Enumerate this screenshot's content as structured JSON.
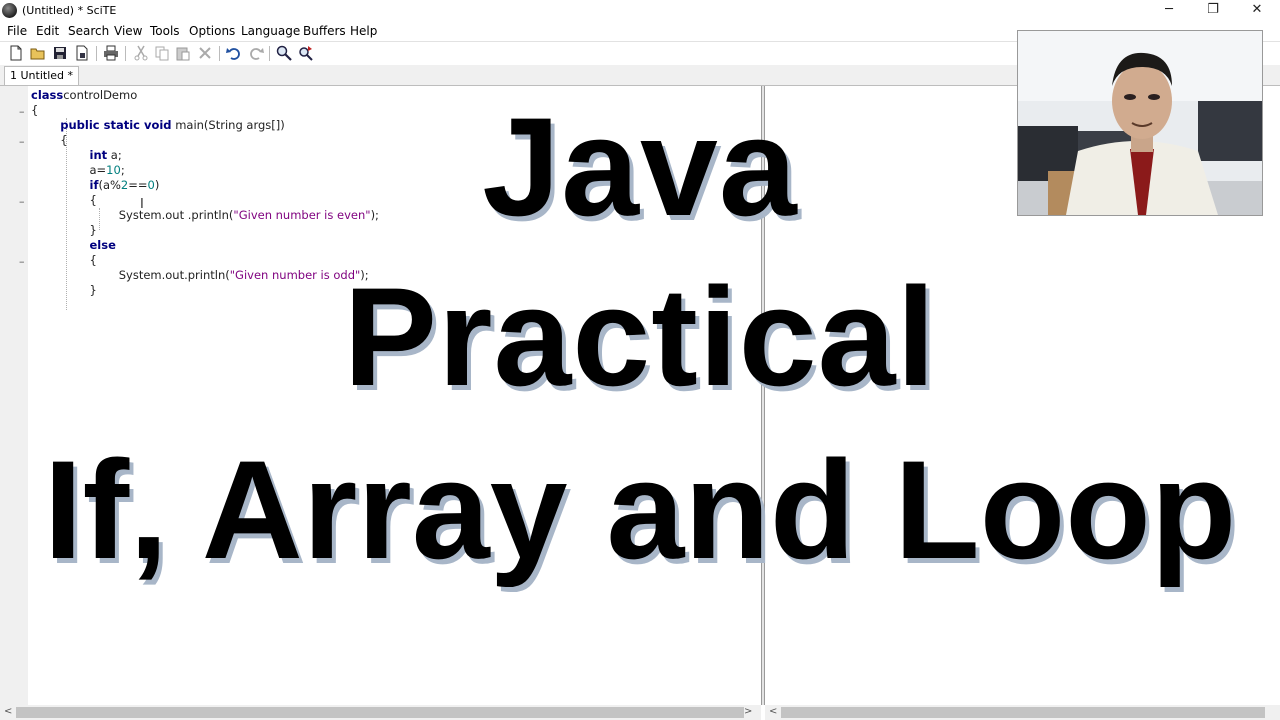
{
  "window": {
    "title": "(Untitled) * SciTE",
    "minimize": "─",
    "restore": "❐",
    "close": "✕"
  },
  "menu": [
    "File",
    "Edit",
    "Search",
    "View",
    "Tools",
    "Options",
    "Language",
    "Buffers",
    "Help"
  ],
  "tabs": [
    {
      "label": "1 Untitled *"
    }
  ],
  "code_lines": [
    [
      [
        "kw",
        "class"
      ],
      [
        "",
        "controlDemo"
      ]
    ],
    [
      [
        "",
        "{"
      ]
    ],
    [
      [
        "",
        "        "
      ],
      [
        "kw",
        "public static void"
      ],
      [
        "",
        " main(String args[])"
      ]
    ],
    [
      [
        "",
        "        {"
      ]
    ],
    [
      [
        "",
        "                "
      ],
      [
        "kw",
        "int"
      ],
      [
        "",
        " a;"
      ]
    ],
    [
      [
        "",
        "                a="
      ],
      [
        "num",
        "10"
      ],
      [
        "",
        ";"
      ]
    ],
    [
      [
        "",
        "                "
      ],
      [
        "kw",
        "if"
      ],
      [
        "",
        "(a%"
      ],
      [
        "num",
        "2"
      ],
      [
        "",
        "=="
      ],
      [
        "num",
        "0"
      ],
      [
        "",
        ")"
      ]
    ],
    [
      [
        "",
        "                {"
      ]
    ],
    [
      [
        "",
        "                        System.out .println("
      ],
      [
        "str",
        "\"Given number is even\""
      ],
      [
        "",
        ");"
      ]
    ],
    [
      [
        "",
        "                }"
      ]
    ],
    [
      [
        "",
        "                "
      ],
      [
        "kw",
        "else"
      ]
    ],
    [
      [
        "",
        "                {"
      ]
    ],
    [
      [
        "",
        "                        System.out.println("
      ],
      [
        "str",
        "\"Given number is odd\""
      ],
      [
        "",
        ");"
      ]
    ],
    [
      [
        "",
        "                }"
      ]
    ]
  ],
  "overlay": {
    "line1": "Java",
    "line2": "Practical",
    "line3": "If, Array and Loop"
  },
  "icons": [
    "new-file-icon",
    "open-folder-icon",
    "save-icon",
    "save-as-icon",
    "print-icon",
    "cut-icon",
    "copy-icon",
    "paste-icon",
    "delete-icon",
    "undo-icon",
    "redo-icon",
    "find-icon",
    "replace-icon"
  ]
}
